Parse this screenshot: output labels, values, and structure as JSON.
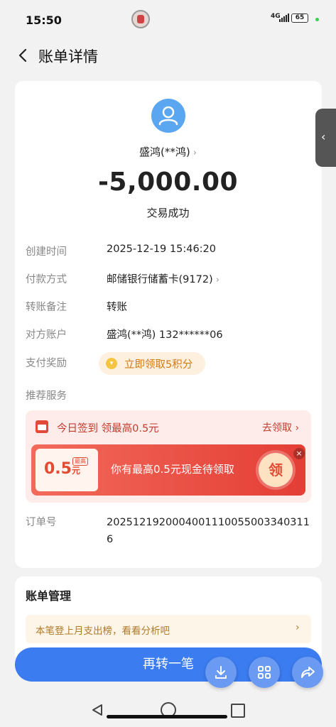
{
  "status_bar": {
    "time": "15:50",
    "network": "4G",
    "battery": "65"
  },
  "nav": {
    "title": "账单详情"
  },
  "payee": {
    "name": "盛鸿(**鸿)",
    "chevron": "›"
  },
  "transaction": {
    "amount": "-5,000.00",
    "status": "交易成功"
  },
  "details": [
    {
      "label": "创建时间",
      "value": "2025-12-19 15:46:20"
    },
    {
      "label": "付款方式",
      "value": "邮储银行储蓄卡(9172)"
    },
    {
      "label": "转账备注",
      "value": "转账"
    },
    {
      "label": "对方账户",
      "value": "盛鸿(**鸿) 132******06"
    },
    {
      "label": "支付奖励",
      "value": "立即领取5积分"
    }
  ],
  "recommend": {
    "label": "推荐服务",
    "checkin_title": "今日签到 领最高0.5元",
    "claim_link": "去领取",
    "coupon_amount": "0.5",
    "coupon_unit": "元",
    "coupon_tag": "最高",
    "banner_text": "你有最高0.5元现金待领取",
    "banner_button": "领"
  },
  "order": {
    "label": "订单号",
    "value": "2025121920004001110055003340311 6"
  },
  "bill_management": {
    "title": "账单管理",
    "notice": "本笔登上月支出榜，看看分析吧"
  },
  "actions": {
    "transfer_again": "再转一笔"
  },
  "icons": [
    "back-icon",
    "user-avatar-icon",
    "chevron-right-icon",
    "coin-icon",
    "calendar-icon",
    "close-icon",
    "download-icon",
    "grid-icon",
    "share-icon",
    "side-collapse-icon"
  ],
  "colors": {
    "primary": "#3b7cf0",
    "promo_red": "#e43e35",
    "reward_orange": "#d77a14"
  }
}
